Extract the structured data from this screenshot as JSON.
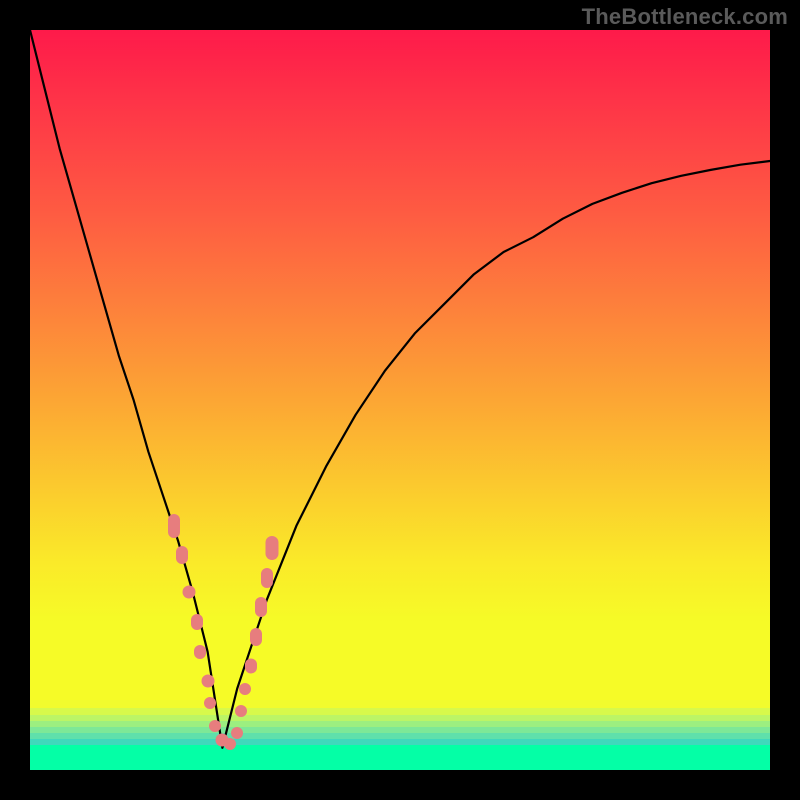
{
  "watermark": "TheBottleneck.com",
  "chart_data": {
    "type": "line",
    "title": "",
    "xlabel": "",
    "ylabel": "",
    "xlim": [
      0,
      100
    ],
    "ylim": [
      0,
      100
    ],
    "grid": false,
    "legend": false,
    "notch_x": 26,
    "series": [
      {
        "name": "bottleneck-curve",
        "x": [
          0,
          2,
          4,
          6,
          8,
          10,
          12,
          14,
          16,
          18,
          20,
          22,
          24,
          26,
          28,
          30,
          32,
          34,
          36,
          38,
          40,
          44,
          48,
          52,
          56,
          60,
          64,
          68,
          72,
          76,
          80,
          84,
          88,
          92,
          96,
          100
        ],
        "y": [
          100,
          92,
          84,
          77,
          70,
          63,
          56,
          50,
          43,
          37,
          31,
          24,
          16,
          3,
          11,
          17,
          23,
          28,
          33,
          37,
          41,
          48,
          54,
          59,
          63,
          67,
          70,
          72,
          74.5,
          76.5,
          78,
          79.3,
          80.3,
          81.1,
          81.8,
          82.3
        ]
      }
    ],
    "scatter": {
      "name": "sample-points",
      "color": "#e77d7e",
      "points": [
        {
          "x": 19.5,
          "y": 33,
          "w": 12,
          "h": 24
        },
        {
          "x": 20.5,
          "y": 29,
          "w": 12,
          "h": 18
        },
        {
          "x": 21.5,
          "y": 24,
          "w": 13,
          "h": 13
        },
        {
          "x": 22.5,
          "y": 20,
          "w": 12,
          "h": 16
        },
        {
          "x": 23,
          "y": 16,
          "w": 12,
          "h": 14
        },
        {
          "x": 24,
          "y": 12,
          "w": 13,
          "h": 13
        },
        {
          "x": 24.3,
          "y": 9,
          "w": 12,
          "h": 12
        },
        {
          "x": 25,
          "y": 6,
          "w": 12,
          "h": 12
        },
        {
          "x": 26,
          "y": 4,
          "w": 13,
          "h": 13
        },
        {
          "x": 27,
          "y": 3.5,
          "w": 12,
          "h": 12
        },
        {
          "x": 28,
          "y": 5,
          "w": 12,
          "h": 12
        },
        {
          "x": 28.5,
          "y": 8,
          "w": 12,
          "h": 12
        },
        {
          "x": 29,
          "y": 11,
          "w": 12,
          "h": 12
        },
        {
          "x": 29.8,
          "y": 14,
          "w": 12,
          "h": 15
        },
        {
          "x": 30.5,
          "y": 18,
          "w": 12,
          "h": 18
        },
        {
          "x": 31.2,
          "y": 22,
          "w": 12,
          "h": 20
        },
        {
          "x": 32,
          "y": 26,
          "w": 12,
          "h": 20
        },
        {
          "x": 32.7,
          "y": 30,
          "w": 13,
          "h": 24
        }
      ]
    },
    "gradient_stops": [
      {
        "pos": 0.0,
        "color": "#fe1a4a"
      },
      {
        "pos": 0.12,
        "color": "#fe3a47"
      },
      {
        "pos": 0.25,
        "color": "#fe5c42"
      },
      {
        "pos": 0.38,
        "color": "#fd823b"
      },
      {
        "pos": 0.5,
        "color": "#fca634"
      },
      {
        "pos": 0.63,
        "color": "#fbce2d"
      },
      {
        "pos": 0.72,
        "color": "#faea29"
      },
      {
        "pos": 0.8,
        "color": "#f6fb27"
      },
      {
        "pos": 1.0,
        "color": "#f6fb27"
      }
    ],
    "bottom_bands": [
      {
        "h": 8,
        "color": "#f1fb2e"
      },
      {
        "h": 7,
        "color": "#d7f94b"
      },
      {
        "h": 6,
        "color": "#bbf566"
      },
      {
        "h": 6,
        "color": "#9cef80"
      },
      {
        "h": 6,
        "color": "#7de897"
      },
      {
        "h": 6,
        "color": "#5fe0ab"
      },
      {
        "h": 6,
        "color": "#3fd8bc"
      },
      {
        "h": 25,
        "color": "#04ffa6"
      }
    ]
  }
}
